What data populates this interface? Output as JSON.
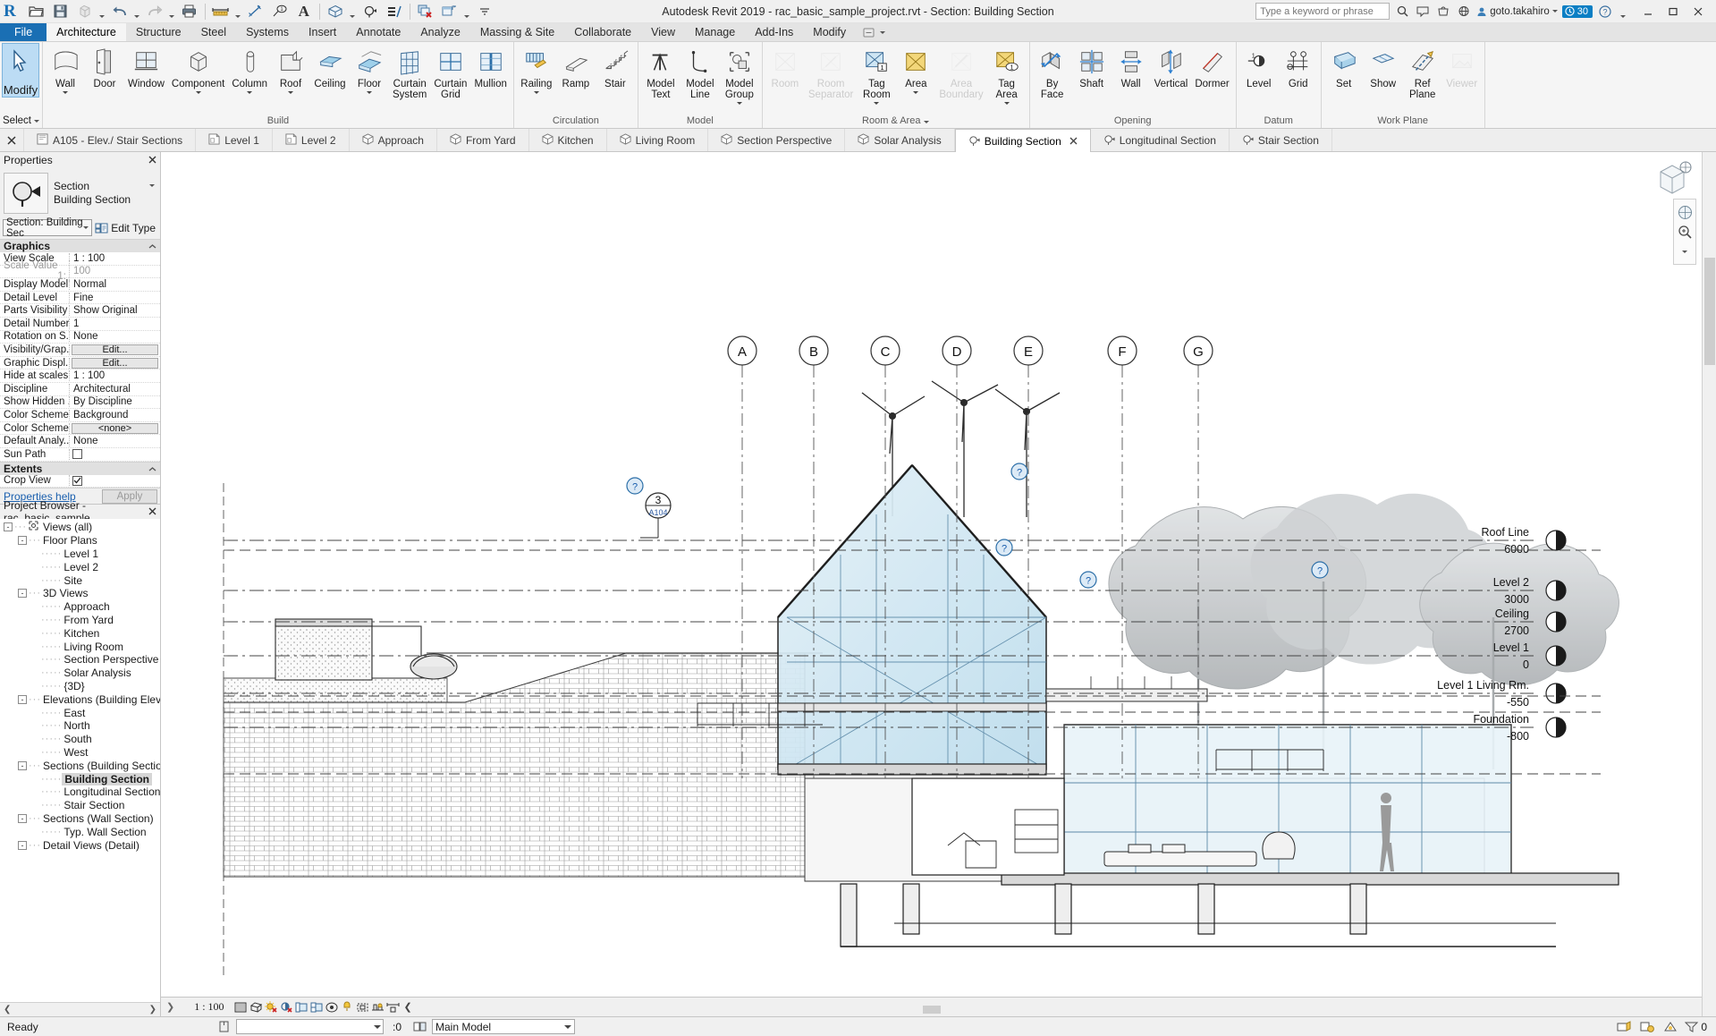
{
  "app": {
    "title": "Autodesk Revit 2019 - rac_basic_sample_project.rvt - Section: Building Section",
    "logo": "R",
    "search_placeholder": "Type a keyword or phrase",
    "user": "goto.takahiro",
    "badge": "30"
  },
  "quick_access": [
    {
      "name": "open-icon",
      "label": "Open"
    },
    {
      "name": "save-icon",
      "label": "Save"
    },
    {
      "name": "save-as-icon",
      "label": "Save As"
    },
    {
      "name": "undo-icon",
      "label": "Undo"
    },
    {
      "name": "redo-icon",
      "label": "Redo"
    },
    {
      "name": "print-icon",
      "label": "Print"
    },
    {
      "name": "measure-icon",
      "label": "Measure"
    },
    {
      "name": "aligned-dimension-icon",
      "label": "Aligned Dimension"
    },
    {
      "name": "tag-icon",
      "label": "Tag by Category"
    },
    {
      "name": "text-icon",
      "label": "Text"
    },
    {
      "name": "default-3d-view-icon",
      "label": "Default 3D View"
    },
    {
      "name": "section-icon",
      "label": "Section"
    },
    {
      "name": "thin-lines-icon",
      "label": "Thin Lines"
    },
    {
      "name": "close-hidden-windows-icon",
      "label": "Close Hidden Windows"
    },
    {
      "name": "switch-windows-icon",
      "label": "Switch Windows"
    },
    {
      "name": "customize-qat-icon",
      "label": "Customize Quick Access Toolbar"
    }
  ],
  "ribbon_tabs": [
    {
      "label": "File",
      "style": "file"
    },
    {
      "label": "Architecture",
      "style": "active"
    },
    {
      "label": "Structure",
      "style": ""
    },
    {
      "label": "Steel",
      "style": ""
    },
    {
      "label": "Systems",
      "style": ""
    },
    {
      "label": "Insert",
      "style": ""
    },
    {
      "label": "Annotate",
      "style": ""
    },
    {
      "label": "Analyze",
      "style": ""
    },
    {
      "label": "Massing & Site",
      "style": ""
    },
    {
      "label": "Collaborate",
      "style": ""
    },
    {
      "label": "View",
      "style": ""
    },
    {
      "label": "Manage",
      "style": ""
    },
    {
      "label": "Add-Ins",
      "style": ""
    },
    {
      "label": "Modify",
      "style": ""
    }
  ],
  "select_panel": {
    "modify_label": "Modify",
    "title": "Select"
  },
  "ribbon_panels": [
    {
      "title": "Build",
      "buttons": [
        {
          "label": "Wall",
          "icon": "wall-icon",
          "dropdown": true,
          "disabled": false
        },
        {
          "label": "Door",
          "icon": "door-icon",
          "dropdown": false,
          "disabled": false
        },
        {
          "label": "Window",
          "icon": "window-icon",
          "dropdown": false,
          "disabled": false
        },
        {
          "label": "Component",
          "icon": "component-icon",
          "dropdown": true,
          "disabled": false
        },
        {
          "label": "Column",
          "icon": "column-icon",
          "dropdown": true,
          "disabled": false
        },
        {
          "label": "Roof",
          "icon": "roof-icon",
          "dropdown": true,
          "disabled": false
        },
        {
          "label": "Ceiling",
          "icon": "ceiling-icon",
          "dropdown": false,
          "disabled": false
        },
        {
          "label": "Floor",
          "icon": "floor-icon",
          "dropdown": true,
          "disabled": false
        },
        {
          "label": "Curtain\nSystem",
          "icon": "curtain-system-icon",
          "dropdown": false,
          "disabled": false
        },
        {
          "label": "Curtain\nGrid",
          "icon": "curtain-grid-icon",
          "dropdown": false,
          "disabled": false
        },
        {
          "label": "Mullion",
          "icon": "mullion-icon",
          "dropdown": false,
          "disabled": false
        }
      ]
    },
    {
      "title": "Circulation",
      "buttons": [
        {
          "label": "Railing",
          "icon": "railing-icon",
          "dropdown": true,
          "disabled": false
        },
        {
          "label": "Ramp",
          "icon": "ramp-icon",
          "dropdown": false,
          "disabled": false
        },
        {
          "label": "Stair",
          "icon": "stair-icon",
          "dropdown": false,
          "disabled": false
        }
      ]
    },
    {
      "title": "Model",
      "buttons": [
        {
          "label": "Model\nText",
          "icon": "model-text-icon",
          "dropdown": false,
          "disabled": false
        },
        {
          "label": "Model\nLine",
          "icon": "model-line-icon",
          "dropdown": false,
          "disabled": false
        },
        {
          "label": "Model\nGroup",
          "icon": "model-group-icon",
          "dropdown": true,
          "disabled": false
        }
      ]
    },
    {
      "title": "Room & Area",
      "dropdown_title": true,
      "buttons": [
        {
          "label": "Room",
          "icon": "room-icon",
          "dropdown": false,
          "disabled": true
        },
        {
          "label": "Room\nSeparator",
          "icon": "room-separator-icon",
          "dropdown": false,
          "disabled": true
        },
        {
          "label": "Tag\nRoom",
          "icon": "tag-room-icon",
          "dropdown": true,
          "disabled": false
        },
        {
          "label": "Area",
          "icon": "area-icon",
          "dropdown": true,
          "disabled": false
        },
        {
          "label": "Area\nBoundary",
          "icon": "area-boundary-icon",
          "dropdown": false,
          "disabled": true
        },
        {
          "label": "Tag\nArea",
          "icon": "tag-area-icon",
          "dropdown": true,
          "disabled": false
        }
      ]
    },
    {
      "title": "Opening",
      "buttons": [
        {
          "label": "By\nFace",
          "icon": "opening-by-face-icon",
          "dropdown": false,
          "disabled": false
        },
        {
          "label": "Shaft",
          "icon": "shaft-opening-icon",
          "dropdown": false,
          "disabled": false
        },
        {
          "label": "Wall",
          "icon": "wall-opening-icon",
          "dropdown": false,
          "disabled": false
        },
        {
          "label": "Vertical",
          "icon": "vertical-opening-icon",
          "dropdown": false,
          "disabled": false
        },
        {
          "label": "Dormer",
          "icon": "dormer-opening-icon",
          "dropdown": false,
          "disabled": false
        }
      ]
    },
    {
      "title": "Datum",
      "buttons": [
        {
          "label": "Level",
          "icon": "level-icon",
          "dropdown": false,
          "disabled": false
        },
        {
          "label": "Grid",
          "icon": "grid-icon",
          "dropdown": false,
          "disabled": false
        }
      ]
    },
    {
      "title": "Work Plane",
      "buttons": [
        {
          "label": "Set",
          "icon": "set-workplane-icon",
          "dropdown": false,
          "disabled": false
        },
        {
          "label": "Show",
          "icon": "show-workplane-icon",
          "dropdown": false,
          "disabled": false
        },
        {
          "label": "Ref\nPlane",
          "icon": "ref-plane-icon",
          "dropdown": false,
          "disabled": false
        },
        {
          "label": "Viewer",
          "icon": "workplane-viewer-icon",
          "dropdown": false,
          "disabled": true
        }
      ]
    }
  ],
  "view_tabs": [
    {
      "label": "A105 - Elev./ Stair Sections",
      "icon": "sheet-icon",
      "active": false
    },
    {
      "label": "Level 1",
      "icon": "plan-icon",
      "active": false
    },
    {
      "label": "Level 2",
      "icon": "plan-icon",
      "active": false
    },
    {
      "label": "Approach",
      "icon": "3d-icon",
      "active": false
    },
    {
      "label": "From Yard",
      "icon": "3d-icon",
      "active": false
    },
    {
      "label": "Kitchen",
      "icon": "3d-icon",
      "active": false
    },
    {
      "label": "Living Room",
      "icon": "3d-icon",
      "active": false
    },
    {
      "label": "Section Perspective",
      "icon": "3d-icon",
      "active": false
    },
    {
      "label": "Solar Analysis",
      "icon": "3d-icon",
      "active": false
    },
    {
      "label": "Building Section",
      "icon": "section-tab-icon",
      "active": true
    },
    {
      "label": "Longitudinal Section",
      "icon": "section-tab-icon",
      "active": false
    },
    {
      "label": "Stair Section",
      "icon": "section-tab-icon",
      "active": false
    }
  ],
  "properties": {
    "panel_title": "Properties",
    "family": "Section",
    "type": "Building Section",
    "type_selector": "Section: Building Sec",
    "edit_type": "Edit Type",
    "groups": [
      {
        "name": "Graphics",
        "rows": [
          {
            "key": "View Scale",
            "value": "1 : 100",
            "kind": "text"
          },
          {
            "key": "Scale Value",
            "sub": "1:",
            "value": "100",
            "kind": "text",
            "dim": true
          },
          {
            "key": "Display Model",
            "value": "Normal",
            "kind": "text"
          },
          {
            "key": "Detail Level",
            "value": "Fine",
            "kind": "text"
          },
          {
            "key": "Parts Visibility",
            "value": "Show Original",
            "kind": "text"
          },
          {
            "key": "Detail Number",
            "value": "1",
            "kind": "text"
          },
          {
            "key": "Rotation on S...",
            "value": "None",
            "kind": "text"
          },
          {
            "key": "Visibility/Grap...",
            "value": "Edit...",
            "kind": "button"
          },
          {
            "key": "Graphic Displ...",
            "value": "Edit...",
            "kind": "button"
          },
          {
            "key": "Hide at scales ...",
            "value": "1 : 100",
            "kind": "text"
          },
          {
            "key": "Discipline",
            "value": "Architectural",
            "kind": "text"
          },
          {
            "key": "Show Hidden ...",
            "value": "By Discipline",
            "kind": "text"
          },
          {
            "key": "Color Scheme...",
            "value": "Background",
            "kind": "text"
          },
          {
            "key": "Color Scheme",
            "value": "<none>",
            "kind": "button"
          },
          {
            "key": "Default Analy...",
            "value": "None",
            "kind": "text"
          },
          {
            "key": "Sun Path",
            "value": "",
            "kind": "checkbox",
            "checked": false
          }
        ]
      },
      {
        "name": "Extents",
        "rows": [
          {
            "key": "Crop View",
            "value": "",
            "kind": "checkbox",
            "checked": true
          }
        ]
      }
    ],
    "help_link": "Properties help",
    "apply_label": "Apply"
  },
  "project_browser": {
    "title": "Project Browser - rac_basic_sample...",
    "nodes": [
      {
        "label": "Views (all)",
        "depth": 0,
        "expander": "-",
        "icon": "views-icon"
      },
      {
        "label": "Floor Plans",
        "depth": 1,
        "expander": "-"
      },
      {
        "label": "Level 1",
        "depth": 2,
        "expander": ""
      },
      {
        "label": "Level 2",
        "depth": 2,
        "expander": ""
      },
      {
        "label": "Site",
        "depth": 2,
        "expander": ""
      },
      {
        "label": "3D Views",
        "depth": 1,
        "expander": "-"
      },
      {
        "label": "Approach",
        "depth": 2,
        "expander": ""
      },
      {
        "label": "From Yard",
        "depth": 2,
        "expander": ""
      },
      {
        "label": "Kitchen",
        "depth": 2,
        "expander": ""
      },
      {
        "label": "Living Room",
        "depth": 2,
        "expander": ""
      },
      {
        "label": "Section Perspective",
        "depth": 2,
        "expander": ""
      },
      {
        "label": "Solar Analysis",
        "depth": 2,
        "expander": ""
      },
      {
        "label": "{3D}",
        "depth": 2,
        "expander": ""
      },
      {
        "label": "Elevations (Building Elevation)",
        "depth": 1,
        "expander": "-"
      },
      {
        "label": "East",
        "depth": 2,
        "expander": ""
      },
      {
        "label": "North",
        "depth": 2,
        "expander": ""
      },
      {
        "label": "South",
        "depth": 2,
        "expander": ""
      },
      {
        "label": "West",
        "depth": 2,
        "expander": ""
      },
      {
        "label": "Sections (Building Section)",
        "depth": 1,
        "expander": "-"
      },
      {
        "label": "Building Section",
        "depth": 2,
        "expander": "",
        "selected": true
      },
      {
        "label": "Longitudinal Section",
        "depth": 2,
        "expander": ""
      },
      {
        "label": "Stair Section",
        "depth": 2,
        "expander": ""
      },
      {
        "label": "Sections (Wall Section)",
        "depth": 1,
        "expander": "-"
      },
      {
        "label": "Typ. Wall Section",
        "depth": 2,
        "expander": ""
      },
      {
        "label": "Detail Views (Detail)",
        "depth": 1,
        "expander": "-"
      }
    ]
  },
  "drawing": {
    "grid_bubbles": [
      "A",
      "B",
      "C",
      "D",
      "E",
      "F",
      "G"
    ],
    "section_tag": {
      "number": "3",
      "sheet": "A104"
    },
    "levels": [
      {
        "name": "Roof Line",
        "elevation": "6000"
      },
      {
        "name": "Level 2",
        "elevation": "3000"
      },
      {
        "name": "Ceiling",
        "elevation": "2700"
      },
      {
        "name": "Level 1",
        "elevation": "0"
      },
      {
        "name": "Level 1 Living Rm.",
        "elevation": "-550"
      },
      {
        "name": "Foundation",
        "elevation": "-800"
      }
    ],
    "warning_markers": 4,
    "colors": {
      "glass": "#cfe6f2",
      "glass_dark": "#b6d9ea",
      "linework": "#1a1a1a",
      "tree_gray": "#b9bcbe",
      "hatch": "#6d6d6d",
      "bubble_blue": "#1a6fb4"
    }
  },
  "view_control_bar": {
    "scale": "1 : 100",
    "icons": [
      {
        "name": "detail-level-icon"
      },
      {
        "name": "visual-style-icon"
      },
      {
        "name": "sun-path-off-icon"
      },
      {
        "name": "shadows-off-icon"
      },
      {
        "name": "render-dialog-icon"
      },
      {
        "name": "crop-view-icon"
      },
      {
        "name": "show-crop-region-icon"
      },
      {
        "name": "temporary-hide-isolate-icon"
      },
      {
        "name": "reveal-hidden-elements-icon"
      },
      {
        "name": "analytical-model-icon"
      },
      {
        "name": "constraints-icon"
      },
      {
        "name": "expand-icon"
      }
    ]
  },
  "status_bar": {
    "ready": "Ready",
    "select_value": "",
    "count": ":0",
    "model": "Main Model",
    "filter_count": "0",
    "icons": [
      {
        "name": "worksets-icon"
      },
      {
        "name": "design-options-icon"
      },
      {
        "name": "editable-only-icon"
      },
      {
        "name": "exclude-options-icon"
      },
      {
        "name": "filter-icon"
      }
    ]
  }
}
